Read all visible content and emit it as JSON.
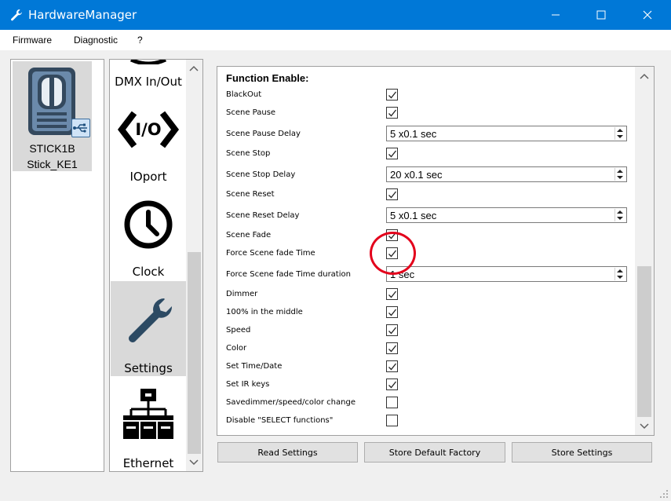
{
  "window": {
    "title": "HardwareManager",
    "minimize": "minimize-icon",
    "maximize": "maximize-icon",
    "close": "close-icon"
  },
  "menu": {
    "firmware": "Firmware",
    "diagnostic": "Diagnostic",
    "help": "?"
  },
  "device": {
    "line1": "STICK1B",
    "line2": "Stick_KE1",
    "icon": "usb-icon"
  },
  "nav": {
    "dmx": "DMX In/Out",
    "ioport_icon_text": "I/O",
    "ioport": "IOport",
    "clock": "Clock",
    "settings": "Settings",
    "ethernet": "Ethernet"
  },
  "content": {
    "section_title": "Function Enable:",
    "rows": [
      {
        "label": "BlackOut",
        "type": "checkbox",
        "checked": true
      },
      {
        "label": "Scene Pause",
        "type": "checkbox",
        "checked": true
      },
      {
        "label": "Scene Pause Delay",
        "type": "spin",
        "value": "5 x0.1 sec"
      },
      {
        "label": "Scene Stop",
        "type": "checkbox",
        "checked": true
      },
      {
        "label": "Scene Stop Delay",
        "type": "spin",
        "value": "20 x0.1 sec"
      },
      {
        "label": "Scene Reset",
        "type": "checkbox",
        "checked": true
      },
      {
        "label": "Scene Reset Delay",
        "type": "spin",
        "value": "5 x0.1 sec"
      },
      {
        "label": "Scene Fade",
        "type": "checkbox",
        "checked": true
      },
      {
        "label": "Force Scene fade Time",
        "type": "checkbox",
        "checked": true
      },
      {
        "label": "Force Scene fade Time duration",
        "type": "spin",
        "value": "1 sec"
      },
      {
        "label": "Dimmer",
        "type": "checkbox",
        "checked": true
      },
      {
        "label": "100% in the middle",
        "type": "checkbox",
        "checked": true
      },
      {
        "label": "Speed",
        "type": "checkbox",
        "checked": true
      },
      {
        "label": "Color",
        "type": "checkbox",
        "checked": true
      },
      {
        "label": "Set Time/Date",
        "type": "checkbox",
        "checked": true
      },
      {
        "label": "Set IR keys",
        "type": "checkbox",
        "checked": true
      },
      {
        "label": "Savedimmer/speed/color change",
        "type": "checkbox",
        "checked": false
      },
      {
        "label": "Disable \"SELECT functions\"",
        "type": "checkbox",
        "checked": false
      }
    ]
  },
  "buttons": {
    "read": "Read Settings",
    "store_default": "Store Default Factory",
    "store": "Store Settings"
  }
}
